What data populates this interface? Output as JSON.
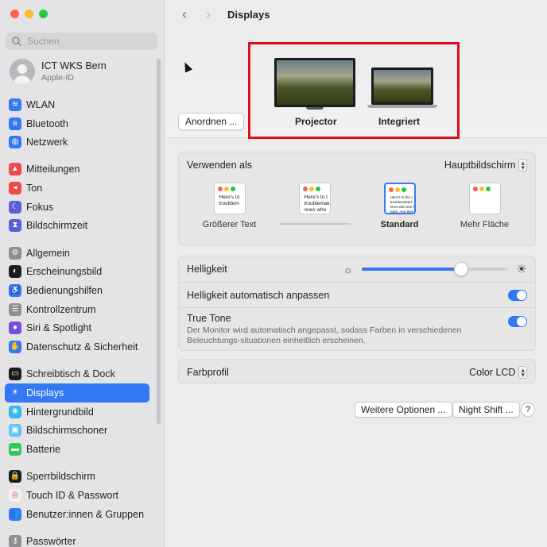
{
  "window": {
    "title": "Displays"
  },
  "search": {
    "placeholder": "Suchen"
  },
  "account": {
    "name": "ICT WKS Bern",
    "subtitle": "Apple-ID"
  },
  "sidebar": {
    "groups": [
      [
        {
          "label": "WLAN",
          "icon": "wifi-icon",
          "color": "#3478f6",
          "glyph": "≋"
        },
        {
          "label": "Bluetooth",
          "icon": "bluetooth-icon",
          "color": "#3478f6",
          "glyph": "ʙ"
        },
        {
          "label": "Netzwerk",
          "icon": "globe-icon",
          "color": "#3478f6",
          "glyph": "◍"
        }
      ],
      [
        {
          "label": "Mitteilungen",
          "icon": "bell-icon",
          "color": "#f4474a",
          "glyph": "▲"
        },
        {
          "label": "Ton",
          "icon": "speaker-icon",
          "color": "#f4474a",
          "glyph": "◂"
        },
        {
          "label": "Fokus",
          "icon": "moon-icon",
          "color": "#5b5fd6",
          "glyph": "☾"
        },
        {
          "label": "Bildschirmzeit",
          "icon": "hourglass-icon",
          "color": "#5b5fd6",
          "glyph": "⧗"
        }
      ],
      [
        {
          "label": "Allgemein",
          "icon": "gear-icon",
          "color": "#8e8e93",
          "glyph": "⚙"
        },
        {
          "label": "Erscheinungsbild",
          "icon": "appearance-icon",
          "color": "#1c1c1e",
          "glyph": "◐"
        },
        {
          "label": "Bedienungshilfen",
          "icon": "accessibility-icon",
          "color": "#3478f6",
          "glyph": "♿"
        },
        {
          "label": "Kontrollzentrum",
          "icon": "control-center-icon",
          "color": "#8e8e93",
          "glyph": "☰"
        },
        {
          "label": "Siri & Spotlight",
          "icon": "siri-icon",
          "color": "#7b4ce0",
          "glyph": "●"
        },
        {
          "label": "Datenschutz & Sicherheit",
          "icon": "hand-icon",
          "color": "#3478f6",
          "glyph": "✋"
        }
      ],
      [
        {
          "label": "Schreibtisch & Dock",
          "icon": "dock-icon",
          "color": "#1c1c1e",
          "glyph": "▭"
        },
        {
          "label": "Displays",
          "icon": "sun-icon",
          "color": "#3478f6",
          "glyph": "☀",
          "active": true
        },
        {
          "label": "Hintergrundbild",
          "icon": "wallpaper-icon",
          "color": "#38b6f0",
          "glyph": "❀"
        },
        {
          "label": "Bildschirmschoner",
          "icon": "screensaver-icon",
          "color": "#5ac8fa",
          "glyph": "▣"
        },
        {
          "label": "Batterie",
          "icon": "battery-icon",
          "color": "#34c759",
          "glyph": "▬"
        }
      ],
      [
        {
          "label": "Sperrbildschirm",
          "icon": "lock-screen-icon",
          "color": "#1c1c1e",
          "glyph": "🔒"
        },
        {
          "label": "Touch ID & Passwort",
          "icon": "fingerprint-icon",
          "color": "#f2f2f2",
          "glyph": "◎"
        },
        {
          "label": "Benutzer:innen & Gruppen",
          "icon": "users-icon",
          "color": "#3478f6",
          "glyph": "👥"
        }
      ],
      [
        {
          "label": "Passwörter",
          "icon": "key-icon",
          "color": "#8e8e93",
          "glyph": "⚷"
        }
      ]
    ]
  },
  "arrange": {
    "button_label": "Anordnen ...",
    "displays": [
      {
        "name": "Projector"
      },
      {
        "name": "Integriert"
      }
    ]
  },
  "use_as": {
    "label": "Verwenden als",
    "value": "Hauptbildschirm"
  },
  "resolution": {
    "options": [
      {
        "label": "Größerer Text",
        "preview": "Here's to\ntroublem"
      },
      {
        "label": "",
        "preview": "Here's to t\ntroublemak\nones who"
      },
      {
        "label": "Standard",
        "preview": "Here's to the c\ntroublemakers.\nones who see t\nrules. And they",
        "selected": true
      },
      {
        "label": "Mehr Fläche",
        "preview": "..."
      }
    ]
  },
  "brightness": {
    "label": "Helligkeit",
    "level_percent": 68
  },
  "auto_brightness": {
    "label": "Helligkeit automatisch anpassen",
    "on": true
  },
  "true_tone": {
    "label": "True Tone",
    "description": "Der Monitor wird automatisch angepasst, sodass Farben in verschiedenen Beleuchtungs-situationen einheitlich erscheinen.",
    "on": true
  },
  "color_profile": {
    "label": "Farbprofil",
    "value": "Color LCD"
  },
  "footer": {
    "more_options": "Weitere Optionen ...",
    "night_shift": "Night Shift ...",
    "help": "?"
  },
  "colors": {
    "accent": "#3478f6",
    "highlight_box": "#d9101e"
  }
}
